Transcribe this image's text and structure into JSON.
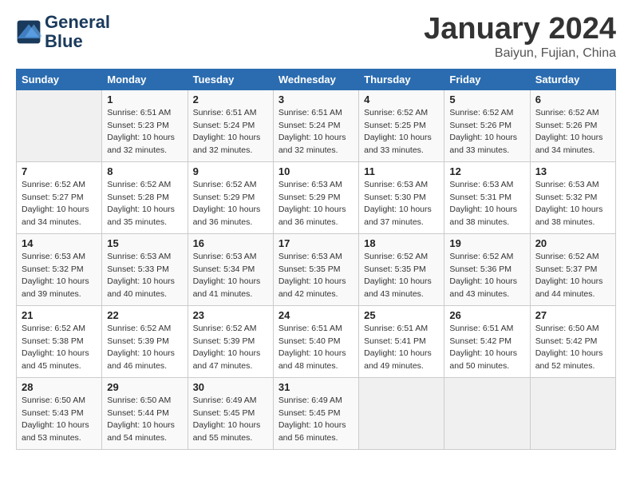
{
  "logo": {
    "line1": "General",
    "line2": "Blue"
  },
  "title": "January 2024",
  "subtitle": "Baiyun, Fujian, China",
  "days_of_week": [
    "Sunday",
    "Monday",
    "Tuesday",
    "Wednesday",
    "Thursday",
    "Friday",
    "Saturday"
  ],
  "weeks": [
    [
      {
        "day": "",
        "info": ""
      },
      {
        "day": "1",
        "info": "Sunrise: 6:51 AM\nSunset: 5:23 PM\nDaylight: 10 hours\nand 32 minutes."
      },
      {
        "day": "2",
        "info": "Sunrise: 6:51 AM\nSunset: 5:24 PM\nDaylight: 10 hours\nand 32 minutes."
      },
      {
        "day": "3",
        "info": "Sunrise: 6:51 AM\nSunset: 5:24 PM\nDaylight: 10 hours\nand 32 minutes."
      },
      {
        "day": "4",
        "info": "Sunrise: 6:52 AM\nSunset: 5:25 PM\nDaylight: 10 hours\nand 33 minutes."
      },
      {
        "day": "5",
        "info": "Sunrise: 6:52 AM\nSunset: 5:26 PM\nDaylight: 10 hours\nand 33 minutes."
      },
      {
        "day": "6",
        "info": "Sunrise: 6:52 AM\nSunset: 5:26 PM\nDaylight: 10 hours\nand 34 minutes."
      }
    ],
    [
      {
        "day": "7",
        "info": "Sunrise: 6:52 AM\nSunset: 5:27 PM\nDaylight: 10 hours\nand 34 minutes."
      },
      {
        "day": "8",
        "info": "Sunrise: 6:52 AM\nSunset: 5:28 PM\nDaylight: 10 hours\nand 35 minutes."
      },
      {
        "day": "9",
        "info": "Sunrise: 6:52 AM\nSunset: 5:29 PM\nDaylight: 10 hours\nand 36 minutes."
      },
      {
        "day": "10",
        "info": "Sunrise: 6:53 AM\nSunset: 5:29 PM\nDaylight: 10 hours\nand 36 minutes."
      },
      {
        "day": "11",
        "info": "Sunrise: 6:53 AM\nSunset: 5:30 PM\nDaylight: 10 hours\nand 37 minutes."
      },
      {
        "day": "12",
        "info": "Sunrise: 6:53 AM\nSunset: 5:31 PM\nDaylight: 10 hours\nand 38 minutes."
      },
      {
        "day": "13",
        "info": "Sunrise: 6:53 AM\nSunset: 5:32 PM\nDaylight: 10 hours\nand 38 minutes."
      }
    ],
    [
      {
        "day": "14",
        "info": "Sunrise: 6:53 AM\nSunset: 5:32 PM\nDaylight: 10 hours\nand 39 minutes."
      },
      {
        "day": "15",
        "info": "Sunrise: 6:53 AM\nSunset: 5:33 PM\nDaylight: 10 hours\nand 40 minutes."
      },
      {
        "day": "16",
        "info": "Sunrise: 6:53 AM\nSunset: 5:34 PM\nDaylight: 10 hours\nand 41 minutes."
      },
      {
        "day": "17",
        "info": "Sunrise: 6:53 AM\nSunset: 5:35 PM\nDaylight: 10 hours\nand 42 minutes."
      },
      {
        "day": "18",
        "info": "Sunrise: 6:52 AM\nSunset: 5:35 PM\nDaylight: 10 hours\nand 43 minutes."
      },
      {
        "day": "19",
        "info": "Sunrise: 6:52 AM\nSunset: 5:36 PM\nDaylight: 10 hours\nand 43 minutes."
      },
      {
        "day": "20",
        "info": "Sunrise: 6:52 AM\nSunset: 5:37 PM\nDaylight: 10 hours\nand 44 minutes."
      }
    ],
    [
      {
        "day": "21",
        "info": "Sunrise: 6:52 AM\nSunset: 5:38 PM\nDaylight: 10 hours\nand 45 minutes."
      },
      {
        "day": "22",
        "info": "Sunrise: 6:52 AM\nSunset: 5:39 PM\nDaylight: 10 hours\nand 46 minutes."
      },
      {
        "day": "23",
        "info": "Sunrise: 6:52 AM\nSunset: 5:39 PM\nDaylight: 10 hours\nand 47 minutes."
      },
      {
        "day": "24",
        "info": "Sunrise: 6:51 AM\nSunset: 5:40 PM\nDaylight: 10 hours\nand 48 minutes."
      },
      {
        "day": "25",
        "info": "Sunrise: 6:51 AM\nSunset: 5:41 PM\nDaylight: 10 hours\nand 49 minutes."
      },
      {
        "day": "26",
        "info": "Sunrise: 6:51 AM\nSunset: 5:42 PM\nDaylight: 10 hours\nand 50 minutes."
      },
      {
        "day": "27",
        "info": "Sunrise: 6:50 AM\nSunset: 5:42 PM\nDaylight: 10 hours\nand 52 minutes."
      }
    ],
    [
      {
        "day": "28",
        "info": "Sunrise: 6:50 AM\nSunset: 5:43 PM\nDaylight: 10 hours\nand 53 minutes."
      },
      {
        "day": "29",
        "info": "Sunrise: 6:50 AM\nSunset: 5:44 PM\nDaylight: 10 hours\nand 54 minutes."
      },
      {
        "day": "30",
        "info": "Sunrise: 6:49 AM\nSunset: 5:45 PM\nDaylight: 10 hours\nand 55 minutes."
      },
      {
        "day": "31",
        "info": "Sunrise: 6:49 AM\nSunset: 5:45 PM\nDaylight: 10 hours\nand 56 minutes."
      },
      {
        "day": "",
        "info": ""
      },
      {
        "day": "",
        "info": ""
      },
      {
        "day": "",
        "info": ""
      }
    ]
  ]
}
